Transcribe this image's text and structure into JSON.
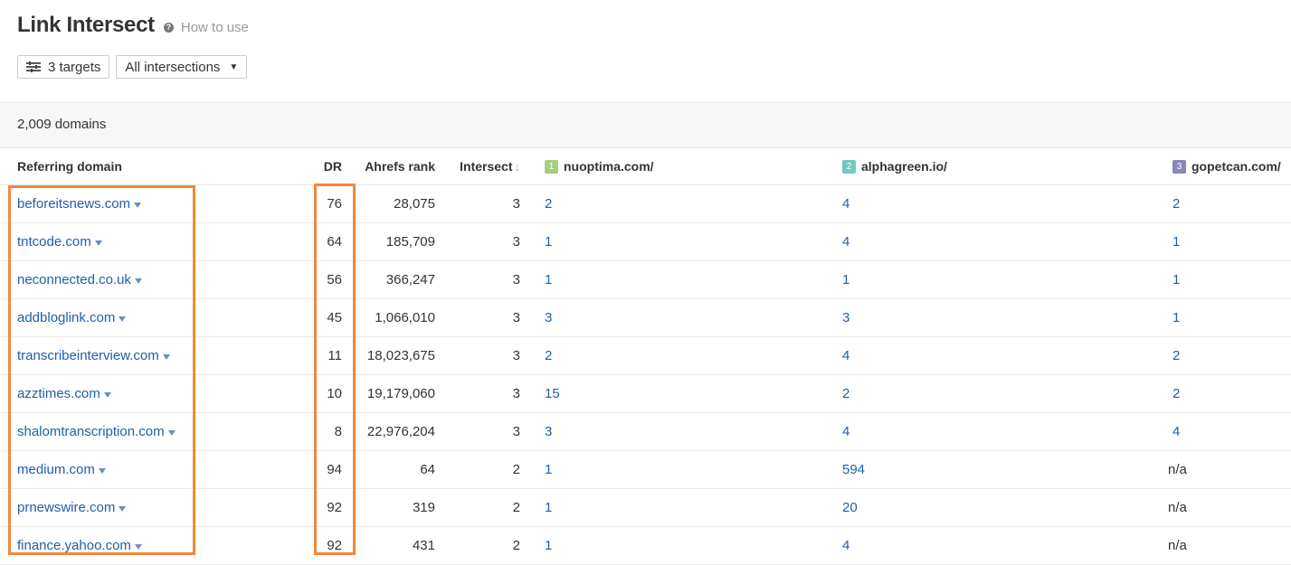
{
  "header": {
    "title": "Link Intersect",
    "help_label": "How to use",
    "help_icon": "question-circle-icon"
  },
  "controls": {
    "targets_label": "3 targets",
    "targets_icon": "sliders-icon",
    "intersections_label": "All intersections"
  },
  "summary": {
    "domains_count": "2,009 domains"
  },
  "columns": {
    "referring_domain": "Referring domain",
    "dr": "DR",
    "ahrefs_rank": "Ahrefs rank",
    "intersect": "Intersect",
    "targets": [
      {
        "index": "1",
        "name": "nuoptima.com/",
        "color": "#a6cf7e"
      },
      {
        "index": "2",
        "name": "alphagreen.io/",
        "color": "#74c7c2"
      },
      {
        "index": "3",
        "name": "gopetcan.com/",
        "color": "#8a86b8"
      }
    ]
  },
  "rows": [
    {
      "domain": "beforeitsnews.com",
      "dr": "76",
      "rank": "28,075",
      "intersect": "3",
      "t1": "2",
      "t2": "4",
      "t3": "2"
    },
    {
      "domain": "tntcode.com",
      "dr": "64",
      "rank": "185,709",
      "intersect": "3",
      "t1": "1",
      "t2": "4",
      "t3": "1"
    },
    {
      "domain": "neconnected.co.uk",
      "dr": "56",
      "rank": "366,247",
      "intersect": "3",
      "t1": "1",
      "t2": "1",
      "t3": "1"
    },
    {
      "domain": "addbloglink.com",
      "dr": "45",
      "rank": "1,066,010",
      "intersect": "3",
      "t1": "3",
      "t2": "3",
      "t3": "1"
    },
    {
      "domain": "transcribeinterview.com",
      "dr": "11",
      "rank": "18,023,675",
      "intersect": "3",
      "t1": "2",
      "t2": "4",
      "t3": "2"
    },
    {
      "domain": "azztimes.com",
      "dr": "10",
      "rank": "19,179,060",
      "intersect": "3",
      "t1": "15",
      "t2": "2",
      "t3": "2"
    },
    {
      "domain": "shalomtranscription.com",
      "dr": "8",
      "rank": "22,976,204",
      "intersect": "3",
      "t1": "3",
      "t2": "4",
      "t3": "4"
    },
    {
      "domain": "medium.com",
      "dr": "94",
      "rank": "64",
      "intersect": "2",
      "t1": "1",
      "t2": "594",
      "t3": "n/a"
    },
    {
      "domain": "prnewswire.com",
      "dr": "92",
      "rank": "319",
      "intersect": "2",
      "t1": "1",
      "t2": "20",
      "t3": "n/a"
    },
    {
      "domain": "finance.yahoo.com",
      "dr": "92",
      "rank": "431",
      "intersect": "2",
      "t1": "1",
      "t2": "4",
      "t3": "n/a"
    }
  ],
  "highlight_color": "#f0883a"
}
